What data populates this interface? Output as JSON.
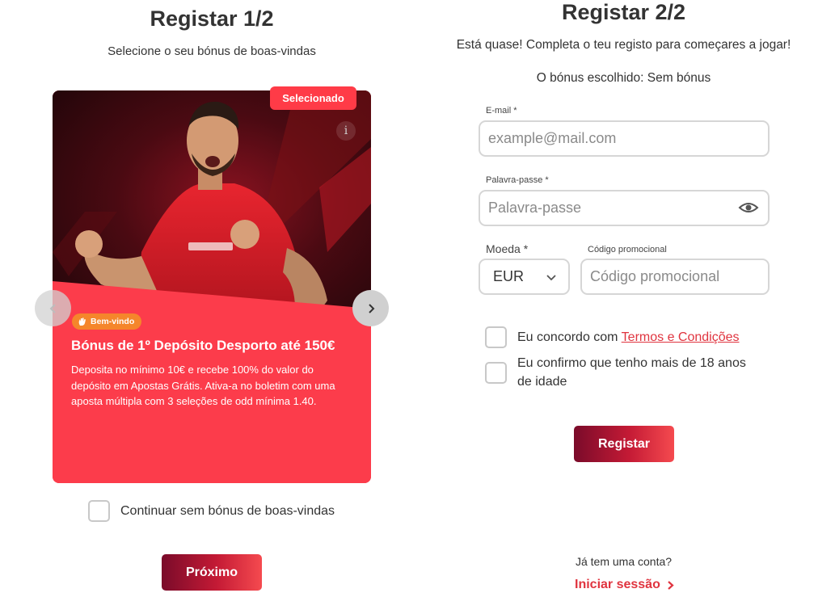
{
  "step1": {
    "title": "Registar 1/2",
    "subtitle": "Selecione o seu bónus de boas-vindas",
    "card": {
      "selected_badge": "Selecionado",
      "info_icon": "info-icon",
      "welcome_badge": "Bem-vindo",
      "bonus_title": "Bónus de 1º Depósito Desporto até 150€",
      "bonus_description": "Deposita no mínimo 10€ e recebe 100% do valor do depósito em Apostas Grátis. Ativa-a no boletim com uma aposta múltipla com 3 seleções de odd mínima 1.40."
    },
    "no_bonus_label": "Continuar sem bónus de boas-vindas",
    "next_button": "Próximo"
  },
  "step2": {
    "title": "Registar 2/2",
    "subtitle": "Está quase! Completa o teu registo para começares a jogar!",
    "chosen_bonus": "O bónus escolhido: Sem bónus",
    "email_label": "E-mail *",
    "email_placeholder": "example@mail.com",
    "password_label": "Palavra-passe *",
    "password_placeholder": "Palavra-passe",
    "currency_label": "Moeda *",
    "currency_value": "EUR",
    "promo_label": "Código promocional",
    "promo_placeholder": "Código promocional",
    "terms_prefix": "Eu concordo com ",
    "terms_link": "Termos e Condições",
    "age_label": "Eu confirmo que tenho mais de 18 anos de idade",
    "register_button": "Registar",
    "have_account": "Já tem uma conta?",
    "login_link": "Iniciar sessão"
  },
  "colors": {
    "card_red": "#fc3c4b",
    "accent": "#e0343f",
    "badge_orange": "#f5862b"
  }
}
